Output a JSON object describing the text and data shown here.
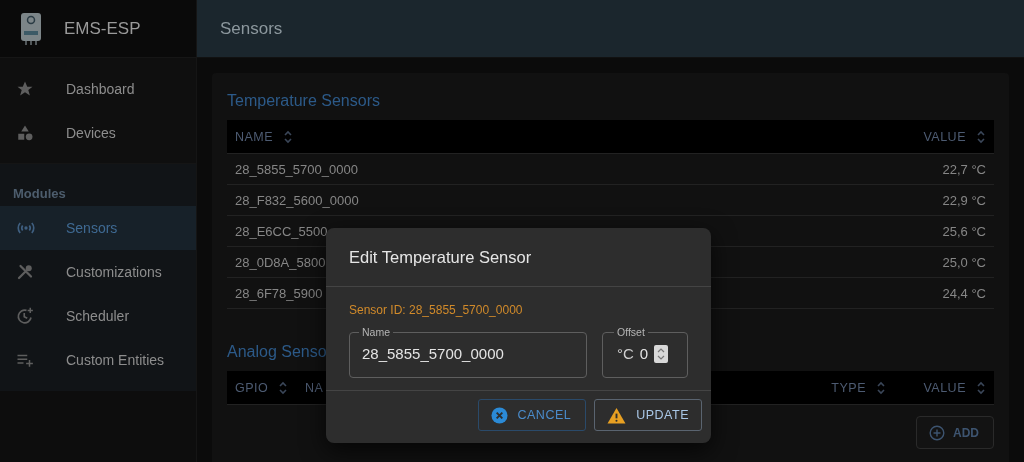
{
  "app": {
    "title": "EMS-ESP"
  },
  "header": {
    "title": "Sensors"
  },
  "sidebar": {
    "items": [
      {
        "label": "Dashboard",
        "selected": false
      },
      {
        "label": "Devices",
        "selected": false
      }
    ],
    "group_label": "Modules",
    "group_items": [
      {
        "label": "Sensors",
        "selected": true
      },
      {
        "label": "Customizations",
        "selected": false
      },
      {
        "label": "Scheduler",
        "selected": false
      },
      {
        "label": "Custom Entities",
        "selected": false
      }
    ]
  },
  "temperature_sensors": {
    "title": "Temperature Sensors",
    "columns": [
      "NAME",
      "VALUE"
    ],
    "rows": [
      [
        "28_5855_5700_0000",
        "22,7 °C"
      ],
      [
        "28_F832_5600_0000",
        "22,9 °C"
      ],
      [
        "28_E6CC_5500",
        "25,6 °C"
      ],
      [
        "28_0D8A_5800",
        "25,0 °C"
      ],
      [
        "28_6F78_5900",
        "24,4 °C"
      ]
    ]
  },
  "analog_sensors": {
    "title": "Analog Senso",
    "columns": [
      "GPIO",
      "NA",
      "TYPE",
      "VALUE"
    ],
    "add_button": "ADD"
  },
  "dialog": {
    "title": "Edit Temperature Sensor",
    "sensor_id": "Sensor ID: 28_5855_5700_0000",
    "fields": [
      {
        "kind": "text",
        "label": "Name",
        "value": "28_5855_5700_0000"
      },
      {
        "kind": "number",
        "label": "Offset",
        "unit": "°C",
        "value": "0"
      }
    ],
    "buttons": [
      {
        "kind": "cancel",
        "label": "CANCEL"
      },
      {
        "kind": "update",
        "label": "UPDATE"
      }
    ]
  }
}
